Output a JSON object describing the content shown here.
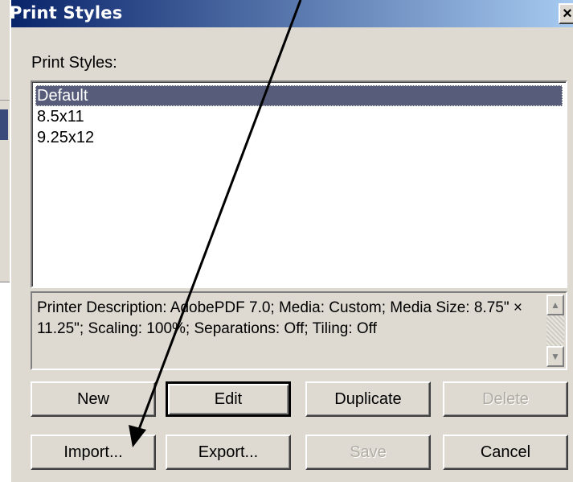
{
  "dialog": {
    "title": "Print Styles",
    "close_glyph": "×"
  },
  "styles_label": "Print Styles:",
  "styles_list": [
    {
      "name": "Default",
      "selected": true
    },
    {
      "name": "8.5x11",
      "selected": false
    },
    {
      "name": "9.25x12",
      "selected": false
    }
  ],
  "description": "Printer Description: AdobePDF 7.0;  Media: Custom;  Media Size: 8.75\" × 11.25\";  Scaling: 100%;  Separations: Off;  Tiling: Off",
  "scroll_icons": {
    "up": "▲",
    "down": "▼"
  },
  "buttons": {
    "new": "New",
    "edit": "Edit",
    "duplicate": "Duplicate",
    "delete": "Delete",
    "import": "Import...",
    "export": "Export...",
    "save": "Save",
    "cancel": "Cancel"
  },
  "colors": {
    "titlebar_start": "#0a246a",
    "titlebar_end": "#a6caf0",
    "dialog_face": "#dedad2",
    "selection": "#565c7a"
  }
}
